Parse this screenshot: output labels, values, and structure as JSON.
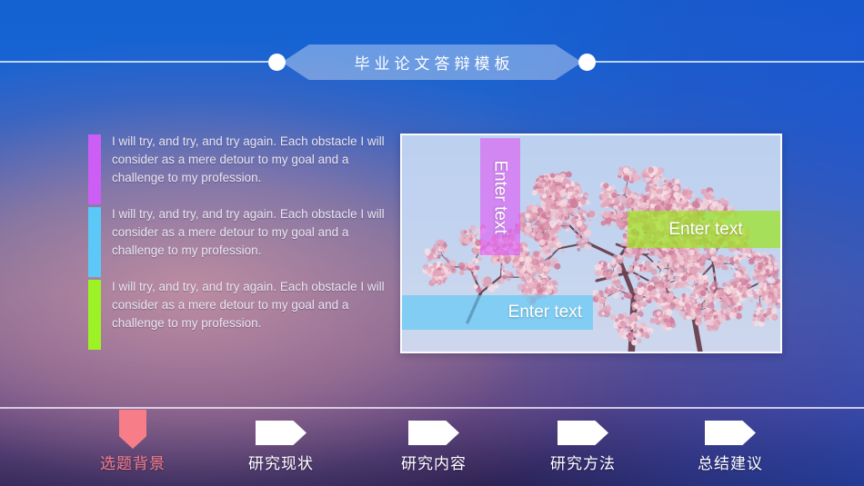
{
  "slide": {
    "title": "毕业论文答辩模板",
    "background": {
      "top_color": "#1362d2",
      "mid_color": "#6a5f92",
      "bottom_color": "#2c2150",
      "glow_color": "#ce96a5"
    }
  },
  "text_blocks": [
    {
      "accent_color": "#cc5ef5",
      "text": "I will try, and try, and try again. Each obstacle I will consider as a mere detour to my goal and a challenge to my profession."
    },
    {
      "accent_color": "#5cc8f8",
      "text": "I will try, and try, and try again. Each obstacle I will consider as a mere detour to my goal and a challenge to my profession."
    },
    {
      "accent_color": "#9df226",
      "text": "I will try, and try, and try again. Each obstacle I will consider as a mere detour to my goal and a challenge to my profession."
    }
  ],
  "picture": {
    "alt": "cherry-blossom-photo",
    "overlays": [
      {
        "label": "Enter text",
        "color": "#df58f3",
        "orientation": "vertical"
      },
      {
        "label": "Enter text",
        "color": "#9ae51c",
        "orientation": "horizontal"
      },
      {
        "label": "Enter text",
        "color": "#60c8f6",
        "orientation": "horizontal"
      }
    ]
  },
  "nav": {
    "active_color": "#f77e88",
    "items": [
      {
        "label": "选题背景",
        "active": true
      },
      {
        "label": "研究现状",
        "active": false
      },
      {
        "label": "研究内容",
        "active": false
      },
      {
        "label": "研究方法",
        "active": false
      },
      {
        "label": "总结建议",
        "active": false
      }
    ]
  }
}
